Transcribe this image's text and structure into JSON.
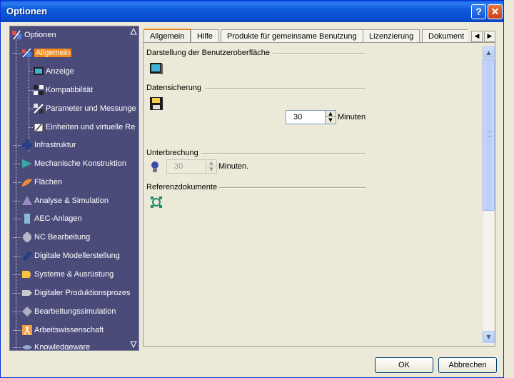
{
  "window": {
    "title": "Optionen"
  },
  "titlebar": {
    "help_label": "?",
    "close_label": "✕"
  },
  "tree": {
    "root_label": "Optionen",
    "items": [
      {
        "label": "Allgemein",
        "icon": "general-icon",
        "selected": true
      },
      {
        "label": "Anzeige",
        "icon": "display-icon"
      },
      {
        "label": "Kompatibilität",
        "icon": "compatibility-icon"
      },
      {
        "label": "Parameter und Messunge",
        "icon": "parameters-icon"
      },
      {
        "label": "Einheiten und virtuelle Re",
        "icon": "units-icon"
      },
      {
        "label": "Infrastruktur",
        "icon": "infrastructure-icon"
      },
      {
        "label": "Mechanische Konstruktion",
        "icon": "mechanical-design-icon"
      },
      {
        "label": "Flächen",
        "icon": "surfaces-icon"
      },
      {
        "label": "Analyse & Simulation",
        "icon": "analysis-icon"
      },
      {
        "label": "AEC-Anlagen",
        "icon": "aec-icon"
      },
      {
        "label": "NC Bearbeitung",
        "icon": "nc-icon"
      },
      {
        "label": "Digitale Modellerstellung",
        "icon": "digital-modeling-icon"
      },
      {
        "label": "Systeme & Ausrüstung",
        "icon": "systems-icon"
      },
      {
        "label": "Digitaler Produktionsprozes",
        "icon": "production-icon"
      },
      {
        "label": "Bearbeitungssimulation",
        "icon": "machining-sim-icon"
      },
      {
        "label": "Arbeitswissenschaft",
        "icon": "ergonomics-icon"
      },
      {
        "label": "Knowledgeware",
        "icon": "knowledgeware-icon"
      }
    ],
    "colors": {
      "background": "#4b4b7a",
      "selected": "#f08a1c"
    }
  },
  "tabs": [
    {
      "label": "Allgemein",
      "active": true
    },
    {
      "label": "Hilfe"
    },
    {
      "label": "Produkte für gemeinsame Benutzung"
    },
    {
      "label": "Lizenzierung"
    },
    {
      "label": "Dokument"
    }
  ],
  "tab_scroll": {
    "left": "◀",
    "right": "▶"
  },
  "sections": {
    "display": {
      "title": "Darstellung der Benutzeroberfläche"
    },
    "backup": {
      "title": "Datensicherung",
      "value": "30",
      "unit": "Minuten"
    },
    "interrupt": {
      "title": "Unterbrechung",
      "value": "30",
      "unit": "Minuten."
    },
    "refdocs": {
      "title": "Referenzdokumente"
    }
  },
  "footer": {
    "ok_label": "OK",
    "cancel_label": "Abbrechen"
  }
}
